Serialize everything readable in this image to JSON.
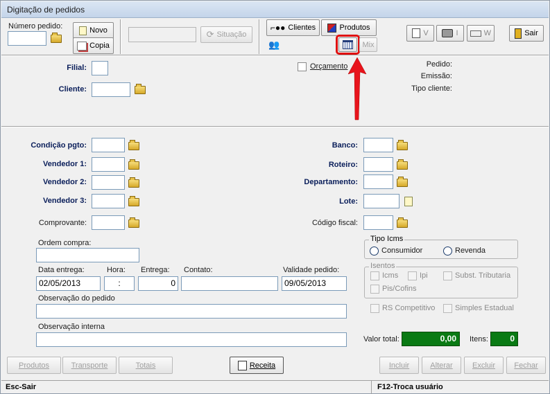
{
  "window": {
    "title": "Digitação de pedidos"
  },
  "toolbar": {
    "numero_pedido_label": "Número pedido:",
    "novo": "Novo",
    "copia": "Copia",
    "situacao": "Situação",
    "clientes": "Clientes",
    "produtos": "Produtos",
    "mix": "Mix",
    "visualizar": "V",
    "imprimir": "I",
    "w": "W",
    "sair": "Sair"
  },
  "header": {
    "filial_label": "Filial:",
    "cliente_label": "Cliente:",
    "orcamento_label": "Orçamento",
    "pedido_label": "Pedido:",
    "emissao_label": "Emissão:",
    "tipo_cliente_label": "Tipo cliente:"
  },
  "form": {
    "condicao_pgto": "Condição pgto:",
    "vendedor1": "Vendedor 1:",
    "vendedor2": "Vendedor 2:",
    "vendedor3": "Vendedor 3:",
    "comprovante": "Comprovante:",
    "banco": "Banco:",
    "roteiro": "Roteiro:",
    "departamento": "Departamento:",
    "lote": "Lote:",
    "codigo_fiscal": "Código fiscal:",
    "ordem_compra": "Ordem compra:",
    "data_entrega_label": "Data entrega:",
    "data_entrega_value": "02/05/2013",
    "hora_label": "Hora:",
    "hora_value": ":",
    "entrega_label": "Entrega:",
    "entrega_value": "0",
    "contato_label": "Contato:",
    "validade_label": "Validade pedido:",
    "validade_value": "09/05/2013",
    "observacao_pedido": "Observação do pedido",
    "observacao_interna": "Observação interna"
  },
  "tipo_icms": {
    "title": "Tipo Icms",
    "consumidor": "Consumidor",
    "revenda": "Revenda"
  },
  "isentos": {
    "title": "Isentos",
    "icms": "Icms",
    "ipi": "Ipi",
    "subst": "Subst. Tributaria",
    "pis": "Pis/Cofins"
  },
  "extras": {
    "rs": "RS Competitivo",
    "simples": "Simples Estadual"
  },
  "totals": {
    "valor_total_label": "Valor total:",
    "valor_total_value": "0,00",
    "itens_label": "Itens:",
    "itens_value": "0"
  },
  "bottom": {
    "produtos": "Produtos",
    "transporte": "Transporte",
    "totais": "Totais",
    "receita": "Receita",
    "incluir": "Incluir",
    "alterar": "Alterar",
    "excluir": "Excluir",
    "fechar": "Fechar"
  },
  "status": {
    "left": "Esc-Sair",
    "right": "F12-Troca usuário"
  },
  "colors": {
    "accent_green": "#0a7a14",
    "label_blue": "#0a1e5a",
    "highlight": "#e01010"
  }
}
